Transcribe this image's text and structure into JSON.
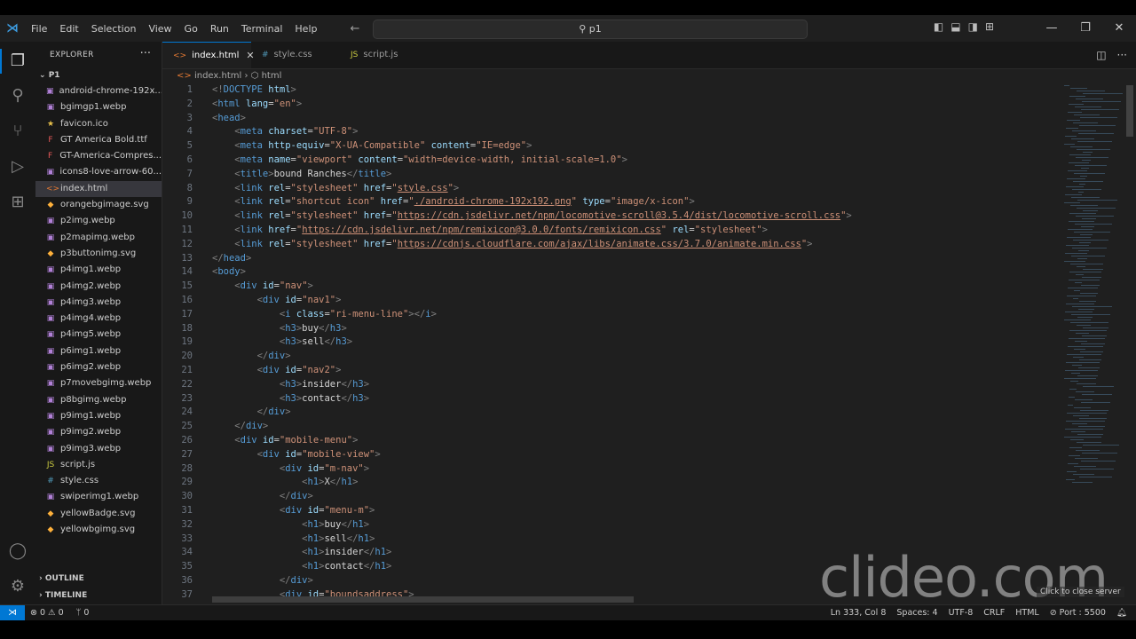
{
  "titlebar": {
    "menu": [
      "File",
      "Edit",
      "Selection",
      "View",
      "Go",
      "Run",
      "Terminal",
      "Help"
    ],
    "search_text": "p1"
  },
  "sidebar": {
    "title": "EXPLORER",
    "folder": "P1",
    "files": [
      {
        "name": "android-chrome-192x...",
        "icon": "image-icon",
        "color": "#b180d7"
      },
      {
        "name": "bgimgp1.webp",
        "icon": "image-icon",
        "color": "#b180d7"
      },
      {
        "name": "favicon.ico",
        "icon": "star-icon",
        "color": "#e8c04a"
      },
      {
        "name": "GT America Bold.ttf",
        "icon": "font-icon",
        "color": "#e45757"
      },
      {
        "name": "GT-America-Compres...",
        "icon": "font-icon",
        "color": "#e45757"
      },
      {
        "name": "icons8-love-arrow-60...",
        "icon": "image-icon",
        "color": "#b180d7"
      },
      {
        "name": "index.html",
        "icon": "html-icon",
        "color": "#e37933"
      },
      {
        "name": "orangebgimage.svg",
        "icon": "svg-icon",
        "color": "#ffb13b"
      },
      {
        "name": "p2img.webp",
        "icon": "image-icon",
        "color": "#b180d7"
      },
      {
        "name": "p2mapimg.webp",
        "icon": "image-icon",
        "color": "#b180d7"
      },
      {
        "name": "p3buttonimg.svg",
        "icon": "svg-icon",
        "color": "#ffb13b"
      },
      {
        "name": "p4img1.webp",
        "icon": "image-icon",
        "color": "#b180d7"
      },
      {
        "name": "p4img2.webp",
        "icon": "image-icon",
        "color": "#b180d7"
      },
      {
        "name": "p4img3.webp",
        "icon": "image-icon",
        "color": "#b180d7"
      },
      {
        "name": "p4img4.webp",
        "icon": "image-icon",
        "color": "#b180d7"
      },
      {
        "name": "p4img5.webp",
        "icon": "image-icon",
        "color": "#b180d7"
      },
      {
        "name": "p6img1.webp",
        "icon": "image-icon",
        "color": "#b180d7"
      },
      {
        "name": "p6img2.webp",
        "icon": "image-icon",
        "color": "#b180d7"
      },
      {
        "name": "p7movebgimg.webp",
        "icon": "image-icon",
        "color": "#b180d7"
      },
      {
        "name": "p8bgimg.webp",
        "icon": "image-icon",
        "color": "#b180d7"
      },
      {
        "name": "p9img1.webp",
        "icon": "image-icon",
        "color": "#b180d7"
      },
      {
        "name": "p9img2.webp",
        "icon": "image-icon",
        "color": "#b180d7"
      },
      {
        "name": "p9img3.webp",
        "icon": "image-icon",
        "color": "#b180d7"
      },
      {
        "name": "script.js",
        "icon": "js-icon",
        "color": "#cbcb41"
      },
      {
        "name": "style.css",
        "icon": "css-icon",
        "color": "#519aba"
      },
      {
        "name": "swiperimg1.webp",
        "icon": "image-icon",
        "color": "#b180d7"
      },
      {
        "name": "yellowBadge.svg",
        "icon": "svg-icon",
        "color": "#ffb13b"
      },
      {
        "name": "yellowbgimg.svg",
        "icon": "svg-icon",
        "color": "#ffb13b"
      }
    ],
    "selected_index": 6,
    "outline": "OUTLINE",
    "timeline": "TIMELINE"
  },
  "tabs": [
    {
      "label": "index.html",
      "icon": "<>",
      "active": true
    },
    {
      "label": "style.css",
      "icon": "#",
      "active": false
    },
    {
      "label": "script.js",
      "icon": "JS",
      "active": false
    }
  ],
  "breadcrumb": {
    "file": "index.html",
    "node": "html"
  },
  "code_lines": [
    [
      [
        "pt",
        "<!"
      ],
      [
        "tg",
        "DOCTYPE"
      ],
      [
        "tx",
        " "
      ],
      [
        "at",
        "html"
      ],
      [
        "pt",
        ">"
      ]
    ],
    [
      [
        "pt",
        "<"
      ],
      [
        "tg",
        "html"
      ],
      [
        "tx",
        " "
      ],
      [
        "at",
        "lang"
      ],
      [
        "tx",
        "="
      ],
      [
        "st",
        "\"en\""
      ],
      [
        "pt",
        ">"
      ]
    ],
    [
      [
        "pt",
        "<"
      ],
      [
        "tg",
        "head"
      ],
      [
        "pt",
        ">"
      ]
    ],
    [
      [
        "tx",
        "    "
      ],
      [
        "pt",
        "<"
      ],
      [
        "tg",
        "meta"
      ],
      [
        "tx",
        " "
      ],
      [
        "at",
        "charset"
      ],
      [
        "tx",
        "="
      ],
      [
        "st",
        "\"UTF-8\""
      ],
      [
        "pt",
        ">"
      ]
    ],
    [
      [
        "tx",
        "    "
      ],
      [
        "pt",
        "<"
      ],
      [
        "tg",
        "meta"
      ],
      [
        "tx",
        " "
      ],
      [
        "at",
        "http-equiv"
      ],
      [
        "tx",
        "="
      ],
      [
        "st",
        "\"X-UA-Compatible\""
      ],
      [
        "tx",
        " "
      ],
      [
        "at",
        "content"
      ],
      [
        "tx",
        "="
      ],
      [
        "st",
        "\"IE=edge\""
      ],
      [
        "pt",
        ">"
      ]
    ],
    [
      [
        "tx",
        "    "
      ],
      [
        "pt",
        "<"
      ],
      [
        "tg",
        "meta"
      ],
      [
        "tx",
        " "
      ],
      [
        "at",
        "name"
      ],
      [
        "tx",
        "="
      ],
      [
        "st",
        "\"viewport\""
      ],
      [
        "tx",
        " "
      ],
      [
        "at",
        "content"
      ],
      [
        "tx",
        "="
      ],
      [
        "st",
        "\"width=device-width, initial-scale=1.0\""
      ],
      [
        "pt",
        ">"
      ]
    ],
    [
      [
        "tx",
        "    "
      ],
      [
        "pt",
        "<"
      ],
      [
        "tg",
        "title"
      ],
      [
        "pt",
        ">"
      ],
      [
        "tt",
        "bound Ranches"
      ],
      [
        "pt",
        "</"
      ],
      [
        "tg",
        "title"
      ],
      [
        "pt",
        ">"
      ]
    ],
    [
      [
        "tx",
        "    "
      ],
      [
        "pt",
        "<"
      ],
      [
        "tg",
        "link"
      ],
      [
        "tx",
        " "
      ],
      [
        "at",
        "rel"
      ],
      [
        "tx",
        "="
      ],
      [
        "st",
        "\"stylesheet\""
      ],
      [
        "tx",
        " "
      ],
      [
        "at",
        "href"
      ],
      [
        "tx",
        "="
      ],
      [
        "st",
        "\""
      ],
      [
        "st u",
        "style.css"
      ],
      [
        "st",
        "\""
      ],
      [
        "pt",
        ">"
      ]
    ],
    [
      [
        "tx",
        "    "
      ],
      [
        "pt",
        "<"
      ],
      [
        "tg",
        "link"
      ],
      [
        "tx",
        " "
      ],
      [
        "at",
        "rel"
      ],
      [
        "tx",
        "="
      ],
      [
        "st",
        "\"shortcut icon\""
      ],
      [
        "tx",
        " "
      ],
      [
        "at",
        "href"
      ],
      [
        "tx",
        "="
      ],
      [
        "st",
        "\""
      ],
      [
        "st u",
        "./android-chrome-192x192.png"
      ],
      [
        "st",
        "\""
      ],
      [
        "tx",
        " "
      ],
      [
        "at",
        "type"
      ],
      [
        "tx",
        "="
      ],
      [
        "st",
        "\"image/x-icon\""
      ],
      [
        "pt",
        ">"
      ]
    ],
    [
      [
        "tx",
        "    "
      ],
      [
        "pt",
        "<"
      ],
      [
        "tg",
        "link"
      ],
      [
        "tx",
        " "
      ],
      [
        "at",
        "rel"
      ],
      [
        "tx",
        "="
      ],
      [
        "st",
        "\"stylesheet\""
      ],
      [
        "tx",
        " "
      ],
      [
        "at",
        "href"
      ],
      [
        "tx",
        "="
      ],
      [
        "st",
        "\""
      ],
      [
        "st u",
        "https://cdn.jsdelivr.net/npm/locomotive-scroll@3.5.4/dist/locomotive-scroll.css"
      ],
      [
        "st",
        "\""
      ],
      [
        "pt",
        ">"
      ]
    ],
    [
      [
        "tx",
        "    "
      ],
      [
        "pt",
        "<"
      ],
      [
        "tg",
        "link"
      ],
      [
        "tx",
        " "
      ],
      [
        "at",
        "href"
      ],
      [
        "tx",
        "="
      ],
      [
        "st",
        "\""
      ],
      [
        "st u",
        "https://cdn.jsdelivr.net/npm/remixicon@3.0.0/fonts/remixicon.css"
      ],
      [
        "st",
        "\""
      ],
      [
        "tx",
        " "
      ],
      [
        "at",
        "rel"
      ],
      [
        "tx",
        "="
      ],
      [
        "st",
        "\"stylesheet\""
      ],
      [
        "pt",
        ">"
      ]
    ],
    [
      [
        "tx",
        "    "
      ],
      [
        "pt",
        "<"
      ],
      [
        "tg",
        "link"
      ],
      [
        "tx",
        " "
      ],
      [
        "at",
        "rel"
      ],
      [
        "tx",
        "="
      ],
      [
        "st",
        "\"stylesheet\""
      ],
      [
        "tx",
        " "
      ],
      [
        "at",
        "href"
      ],
      [
        "tx",
        "="
      ],
      [
        "st",
        "\""
      ],
      [
        "st u",
        "https://cdnjs.cloudflare.com/ajax/libs/animate.css/3.7.0/animate.min.css"
      ],
      [
        "st",
        "\""
      ],
      [
        "pt",
        ">"
      ]
    ],
    [
      [
        "pt",
        "</"
      ],
      [
        "tg",
        "head"
      ],
      [
        "pt",
        ">"
      ]
    ],
    [
      [
        "pt",
        "<"
      ],
      [
        "tg",
        "body"
      ],
      [
        "pt",
        ">"
      ]
    ],
    [
      [
        "tx",
        "    "
      ],
      [
        "pt",
        "<"
      ],
      [
        "tg",
        "div"
      ],
      [
        "tx",
        " "
      ],
      [
        "at",
        "id"
      ],
      [
        "tx",
        "="
      ],
      [
        "st",
        "\"nav\""
      ],
      [
        "pt",
        ">"
      ]
    ],
    [
      [
        "tx",
        "        "
      ],
      [
        "pt",
        "<"
      ],
      [
        "tg",
        "div"
      ],
      [
        "tx",
        " "
      ],
      [
        "at",
        "id"
      ],
      [
        "tx",
        "="
      ],
      [
        "st",
        "\"nav1\""
      ],
      [
        "pt",
        ">"
      ]
    ],
    [
      [
        "tx",
        "            "
      ],
      [
        "pt",
        "<"
      ],
      [
        "tg",
        "i"
      ],
      [
        "tx",
        " "
      ],
      [
        "at",
        "class"
      ],
      [
        "tx",
        "="
      ],
      [
        "st",
        "\"ri-menu-line\""
      ],
      [
        "pt",
        "></"
      ],
      [
        "tg",
        "i"
      ],
      [
        "pt",
        ">"
      ]
    ],
    [
      [
        "tx",
        "            "
      ],
      [
        "pt",
        "<"
      ],
      [
        "tg",
        "h3"
      ],
      [
        "pt",
        ">"
      ],
      [
        "tt",
        "buy"
      ],
      [
        "pt",
        "</"
      ],
      [
        "tg",
        "h3"
      ],
      [
        "pt",
        ">"
      ]
    ],
    [
      [
        "tx",
        "            "
      ],
      [
        "pt",
        "<"
      ],
      [
        "tg",
        "h3"
      ],
      [
        "pt",
        ">"
      ],
      [
        "tt",
        "sell"
      ],
      [
        "pt",
        "</"
      ],
      [
        "tg",
        "h3"
      ],
      [
        "pt",
        ">"
      ]
    ],
    [
      [
        "tx",
        "        "
      ],
      [
        "pt",
        "</"
      ],
      [
        "tg",
        "div"
      ],
      [
        "pt",
        ">"
      ]
    ],
    [
      [
        "tx",
        "        "
      ],
      [
        "pt",
        "<"
      ],
      [
        "tg",
        "div"
      ],
      [
        "tx",
        " "
      ],
      [
        "at",
        "id"
      ],
      [
        "tx",
        "="
      ],
      [
        "st",
        "\"nav2\""
      ],
      [
        "pt",
        ">"
      ]
    ],
    [
      [
        "tx",
        "            "
      ],
      [
        "pt",
        "<"
      ],
      [
        "tg",
        "h3"
      ],
      [
        "pt",
        ">"
      ],
      [
        "tt",
        "insider"
      ],
      [
        "pt",
        "</"
      ],
      [
        "tg",
        "h3"
      ],
      [
        "pt",
        ">"
      ]
    ],
    [
      [
        "tx",
        "            "
      ],
      [
        "pt",
        "<"
      ],
      [
        "tg",
        "h3"
      ],
      [
        "pt",
        ">"
      ],
      [
        "tt",
        "contact"
      ],
      [
        "pt",
        "</"
      ],
      [
        "tg",
        "h3"
      ],
      [
        "pt",
        ">"
      ]
    ],
    [
      [
        "tx",
        "        "
      ],
      [
        "pt",
        "</"
      ],
      [
        "tg",
        "div"
      ],
      [
        "pt",
        ">"
      ]
    ],
    [
      [
        "tx",
        "    "
      ],
      [
        "pt",
        "</"
      ],
      [
        "tg",
        "div"
      ],
      [
        "pt",
        ">"
      ]
    ],
    [
      [
        "tx",
        "    "
      ],
      [
        "pt",
        "<"
      ],
      [
        "tg",
        "div"
      ],
      [
        "tx",
        " "
      ],
      [
        "at",
        "id"
      ],
      [
        "tx",
        "="
      ],
      [
        "st",
        "\"mobile-menu\""
      ],
      [
        "pt",
        ">"
      ]
    ],
    [
      [
        "tx",
        "        "
      ],
      [
        "pt",
        "<"
      ],
      [
        "tg",
        "div"
      ],
      [
        "tx",
        " "
      ],
      [
        "at",
        "id"
      ],
      [
        "tx",
        "="
      ],
      [
        "st",
        "\"mobile-view\""
      ],
      [
        "pt",
        ">"
      ]
    ],
    [
      [
        "tx",
        "            "
      ],
      [
        "pt",
        "<"
      ],
      [
        "tg",
        "div"
      ],
      [
        "tx",
        " "
      ],
      [
        "at",
        "id"
      ],
      [
        "tx",
        "="
      ],
      [
        "st",
        "\"m-nav\""
      ],
      [
        "pt",
        ">"
      ]
    ],
    [
      [
        "tx",
        "                "
      ],
      [
        "pt",
        "<"
      ],
      [
        "tg",
        "h1"
      ],
      [
        "pt",
        ">"
      ],
      [
        "tt",
        "X"
      ],
      [
        "pt",
        "</"
      ],
      [
        "tg",
        "h1"
      ],
      [
        "pt",
        ">"
      ]
    ],
    [
      [
        "tx",
        "            "
      ],
      [
        "pt",
        "</"
      ],
      [
        "tg",
        "div"
      ],
      [
        "pt",
        ">"
      ]
    ],
    [
      [
        "tx",
        "            "
      ],
      [
        "pt",
        "<"
      ],
      [
        "tg",
        "div"
      ],
      [
        "tx",
        " "
      ],
      [
        "at",
        "id"
      ],
      [
        "tx",
        "="
      ],
      [
        "st",
        "\"menu-m\""
      ],
      [
        "pt",
        ">"
      ]
    ],
    [
      [
        "tx",
        "                "
      ],
      [
        "pt",
        "<"
      ],
      [
        "tg",
        "h1"
      ],
      [
        "pt",
        ">"
      ],
      [
        "tt",
        "buy"
      ],
      [
        "pt",
        "</"
      ],
      [
        "tg",
        "h1"
      ],
      [
        "pt",
        ">"
      ]
    ],
    [
      [
        "tx",
        "                "
      ],
      [
        "pt",
        "<"
      ],
      [
        "tg",
        "h1"
      ],
      [
        "pt",
        ">"
      ],
      [
        "tt",
        "sell"
      ],
      [
        "pt",
        "</"
      ],
      [
        "tg",
        "h1"
      ],
      [
        "pt",
        ">"
      ]
    ],
    [
      [
        "tx",
        "                "
      ],
      [
        "pt",
        "<"
      ],
      [
        "tg",
        "h1"
      ],
      [
        "pt",
        ">"
      ],
      [
        "tt",
        "insider"
      ],
      [
        "pt",
        "</"
      ],
      [
        "tg",
        "h1"
      ],
      [
        "pt",
        ">"
      ]
    ],
    [
      [
        "tx",
        "                "
      ],
      [
        "pt",
        "<"
      ],
      [
        "tg",
        "h1"
      ],
      [
        "pt",
        ">"
      ],
      [
        "tt",
        "contact"
      ],
      [
        "pt",
        "</"
      ],
      [
        "tg",
        "h1"
      ],
      [
        "pt",
        ">"
      ]
    ],
    [
      [
        "tx",
        "            "
      ],
      [
        "pt",
        "</"
      ],
      [
        "tg",
        "div"
      ],
      [
        "pt",
        ">"
      ]
    ],
    [
      [
        "tx",
        "            "
      ],
      [
        "pt",
        "<"
      ],
      [
        "tg",
        "div"
      ],
      [
        "tx",
        " "
      ],
      [
        "at",
        "id"
      ],
      [
        "tx",
        "="
      ],
      [
        "st",
        "\"boundsaddress\""
      ],
      [
        "pt",
        ">"
      ]
    ]
  ],
  "watermark": "clideo.com",
  "tooltip": "Click to close server",
  "statusbar": {
    "problems": "⊗ 0 ⚠ 0",
    "ports": "ᛘ 0",
    "position": "Ln 333, Col 8",
    "spaces": "Spaces: 4",
    "encoding": "UTF-8",
    "eol": "CRLF",
    "language": "HTML",
    "port": "⊘ Port : 5500"
  }
}
